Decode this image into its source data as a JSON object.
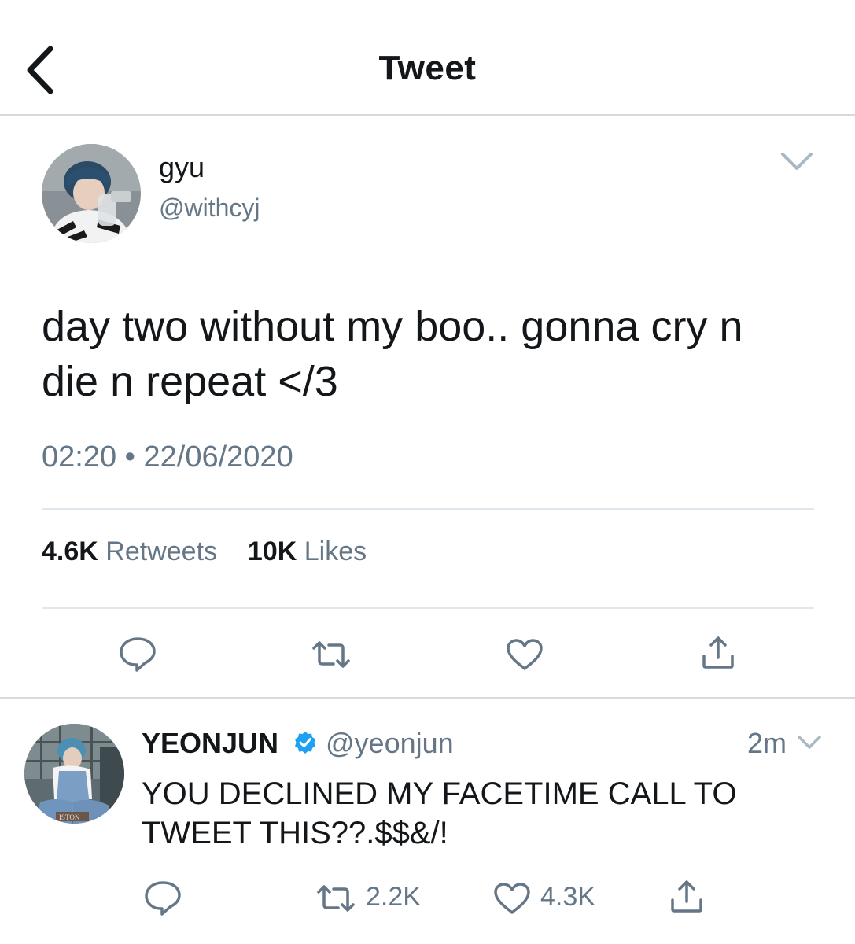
{
  "header": {
    "title": "Tweet"
  },
  "tweet": {
    "author_name": "gyu",
    "author_handle": "@withcyj",
    "text": "day two without my boo.. gonna cry n die n repeat </3",
    "time": "02:20",
    "date": "22/06/2020",
    "time_full": "02:20 • 22/06/2020",
    "retweets_count": "4.6K",
    "retweets_label": "Retweets",
    "likes_count": "10K",
    "likes_label": "Likes"
  },
  "reply": {
    "author_name": "YEONJUN",
    "verified": true,
    "author_handle": "@yeonjun",
    "time": "2m",
    "text": "YOU DECLINED MY FACETIME CALL TO TWEET THIS??.$$&/!",
    "retweets_count": "2.2K",
    "likes_count": "4.3K"
  },
  "colors": {
    "text": "#14171a",
    "secondary": "#657786",
    "divider": "#e1e8ed",
    "verified": "#1da1f2"
  },
  "icons": {
    "back": "chevron-left-icon",
    "more": "chevron-down-icon",
    "reply": "speech-bubble-icon",
    "retweet": "retweet-icon",
    "like": "heart-icon",
    "share": "share-icon",
    "verified": "verified-badge-icon"
  }
}
